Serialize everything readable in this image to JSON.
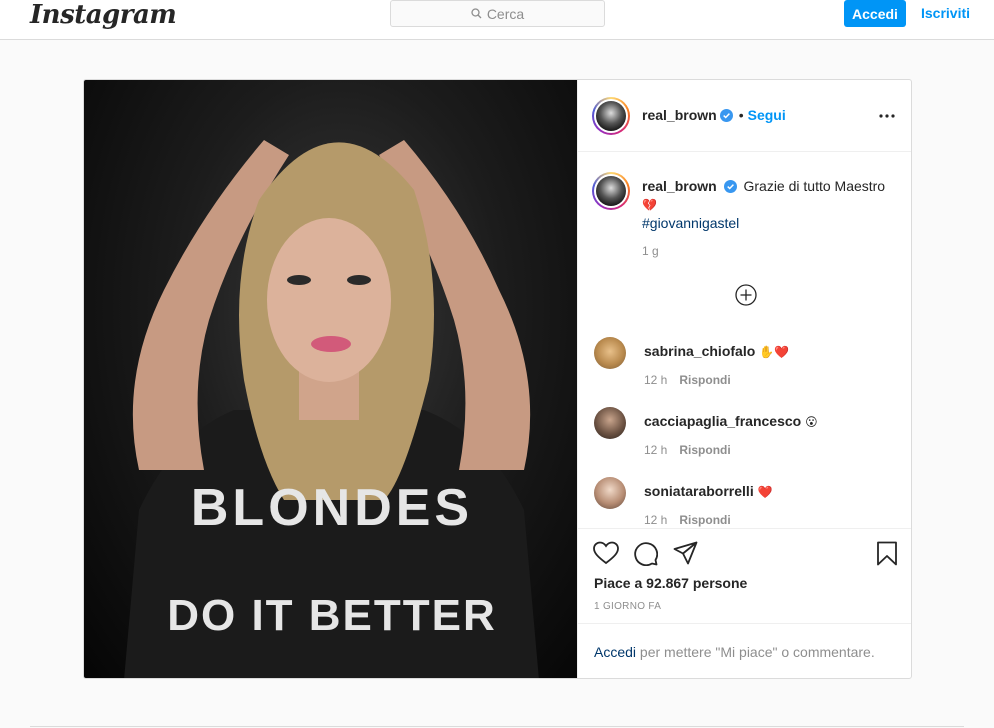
{
  "header": {
    "logo": "Instagram",
    "search_placeholder": "Cerca",
    "login_label": "Accedi",
    "signup_label": "Iscriviti"
  },
  "post": {
    "author": "real_brown",
    "follow_label": "Segui",
    "follow_sep": "•",
    "caption_text": "Grazie di tutto Maestro",
    "caption_emoji": "💔",
    "hashtag": "#giovannigastel",
    "caption_time": "1 g",
    "shirt_text_top": "BLONDES",
    "shirt_text_bottom": "DO IT BETTER",
    "comments": [
      {
        "user": "sabrina_chiofalo",
        "emoji": "✋❤️",
        "time": "12 h",
        "reply": "Rispondi"
      },
      {
        "user": "cacciapaglia_francesco",
        "emoji": "😮",
        "time": "12 h",
        "reply": "Rispondi"
      },
      {
        "user": "soniataraborrelli",
        "emoji": "❤️",
        "time": "12 h",
        "reply": "Rispondi"
      }
    ],
    "likes": "Piace a 92.867 persone",
    "date": "1 GIORNO FA",
    "login_prompt_link": "Accedi",
    "login_prompt_text": " per mettere \"Mi piace\" o commentare."
  },
  "icons": {
    "search": "search-icon",
    "verified": "verified-badge-icon",
    "more": "more-options-icon",
    "load_more": "load-more-comments-icon",
    "like": "heart-icon",
    "comment": "comment-icon",
    "share": "share-icon",
    "save": "bookmark-icon"
  },
  "colors": {
    "accent": "#0095f6",
    "verified": "#3897f0",
    "heart": "#cc1a2b"
  }
}
